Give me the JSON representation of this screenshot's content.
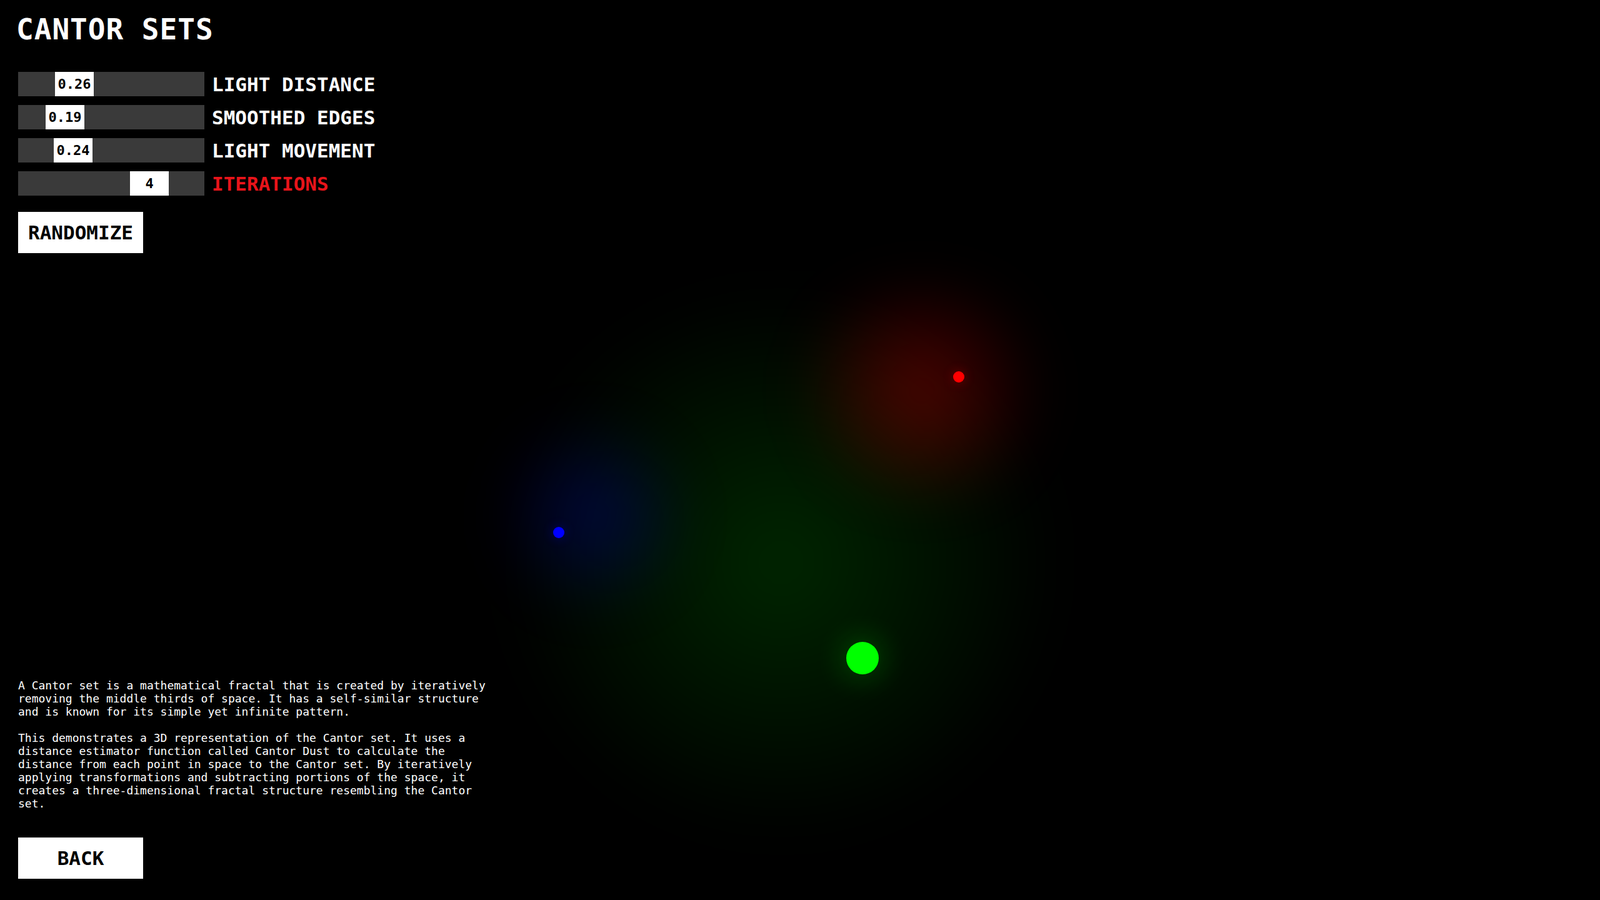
{
  "title": "CANTOR SETS",
  "controls": [
    {
      "label": "LIGHT DISTANCE",
      "value": "0.26",
      "level": 0.25,
      "highlighted": false
    },
    {
      "label": "SMOOTHED EDGES",
      "value": "0.19",
      "level": 0.185,
      "highlighted": false
    },
    {
      "label": "LIGHT MOVEMENT",
      "value": "0.24",
      "level": 0.24,
      "highlighted": false
    },
    {
      "label": "ITERATIONS",
      "value": "4",
      "level": 0.76,
      "highlighted": true
    }
  ],
  "buttons": {
    "randomize": "RANDOMIZE",
    "back": "BACK"
  },
  "description": [
    "A Cantor set is a mathematical fractal that is created by iteratively removing the middle thirds of space. It has a self-similar structure and is known for its simple yet infinite pattern.",
    "This demonstrates a 3D representation of the Cantor set. It uses a distance estimator function called Cantor Dust to calculate the distance from each point in space to the Cantor set. By iteratively applying transformations and subtracting portions of the space, it creates a three-dimensional fractal structure resembling the Cantor set."
  ],
  "scene": {
    "lights": [
      {
        "color": "#00ff00"
      },
      {
        "color": "#0000ff"
      },
      {
        "color": "#ff0000"
      }
    ]
  }
}
